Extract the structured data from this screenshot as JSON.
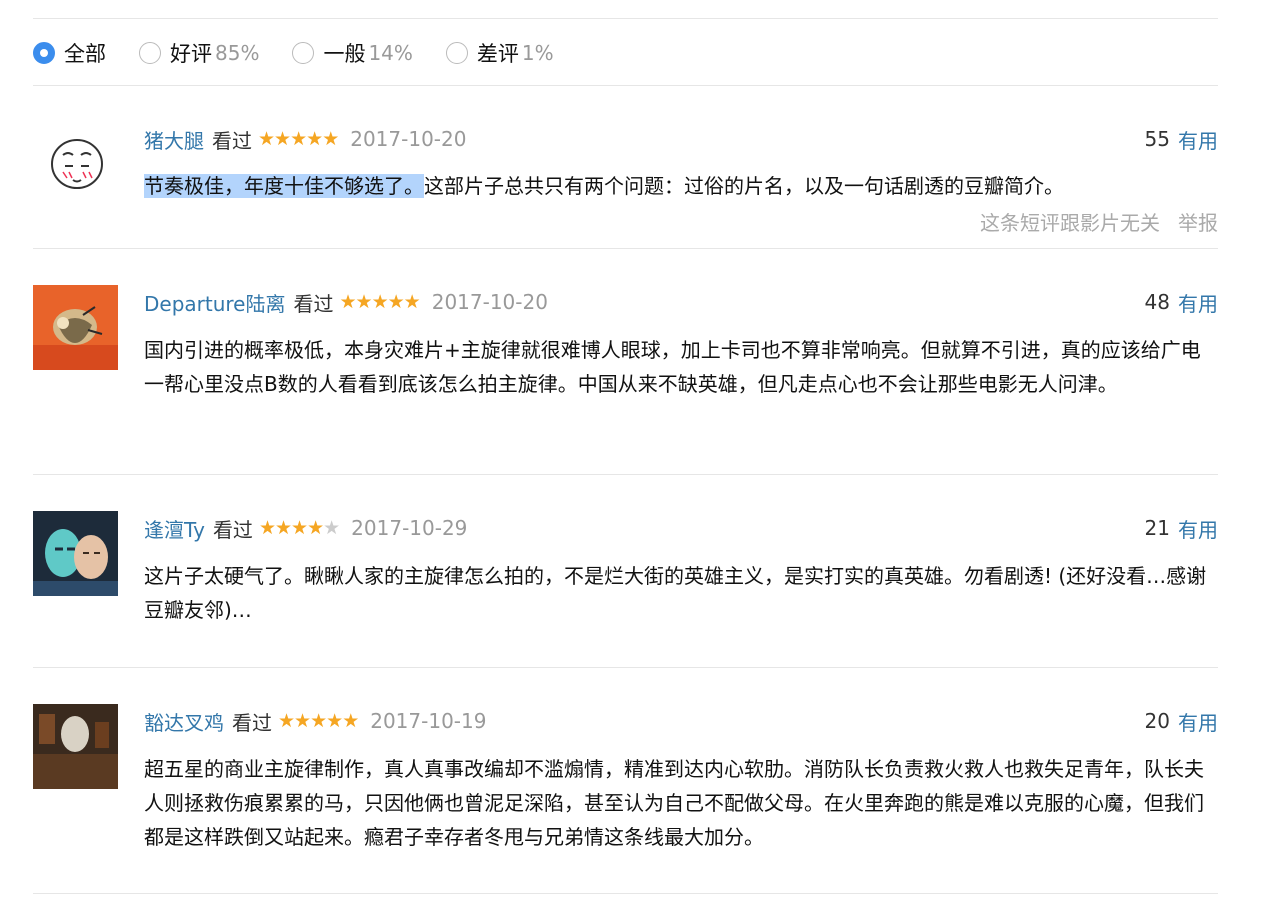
{
  "filters": [
    {
      "label": "全部",
      "pct": "",
      "checked": true
    },
    {
      "label": "好评",
      "pct": "85%",
      "checked": false
    },
    {
      "label": "一般",
      "pct": "14%",
      "checked": false
    },
    {
      "label": "差评",
      "pct": "1%",
      "checked": false
    }
  ],
  "reviews": [
    {
      "user": "猪大腿",
      "status": "看过",
      "rating": 5,
      "date": "2017-10-20",
      "votes": "55",
      "useful_label": "有用",
      "text_highlight": "节奏极佳，年度十佳不够选了。",
      "text": "这部片子总共只有两个问题：过俗的片名，以及一句话剧透的豆瓣简介。",
      "action_unrelated": "这条短评跟影片无关",
      "action_report": "举报"
    },
    {
      "user": "Departure陆离",
      "status": "看过",
      "rating": 5,
      "date": "2017-10-20",
      "votes": "48",
      "useful_label": "有用",
      "text_highlight": "",
      "text": "国内引进的概率极低，本身灾难片+主旋律就很难博人眼球，加上卡司也不算非常响亮。但就算不引进，真的应该给广电一帮心里没点B数的人看看到底该怎么拍主旋律。中国从来不缺英雄，但凡走点心也不会让那些电影无人问津。"
    },
    {
      "user": "逢澶Ty",
      "status": "看过",
      "rating": 4,
      "date": "2017-10-29",
      "votes": "21",
      "useful_label": "有用",
      "text_highlight": "",
      "text": "这片子太硬气了。瞅瞅人家的主旋律怎么拍的，不是烂大街的英雄主义，是实打实的真英雄。勿看剧透! (还好没看…感谢豆瓣友邻)…"
    },
    {
      "user": "豁达叉鸡",
      "status": "看过",
      "rating": 5,
      "date": "2017-10-19",
      "votes": "20",
      "useful_label": "有用",
      "text_highlight": "",
      "text": "超五星的商业主旋律制作，真人真事改编却不滥煽情，精准到达内心软肋。消防队长负责救火救人也救失足青年，队长夫人则拯救伤痕累累的马，只因他俩也曾泥足深陷，甚至认为自己不配做父母。在火里奔跑的熊是难以克服的心魔，但我们都是这样跌倒又站起来。瘾君子幸存者冬甩与兄弟情这条线最大加分。"
    }
  ],
  "colors": {
    "link": "#3377aa",
    "star": "#f5a623",
    "radio_checked": "#3b8ded",
    "highlight": "#b3d4fc"
  }
}
